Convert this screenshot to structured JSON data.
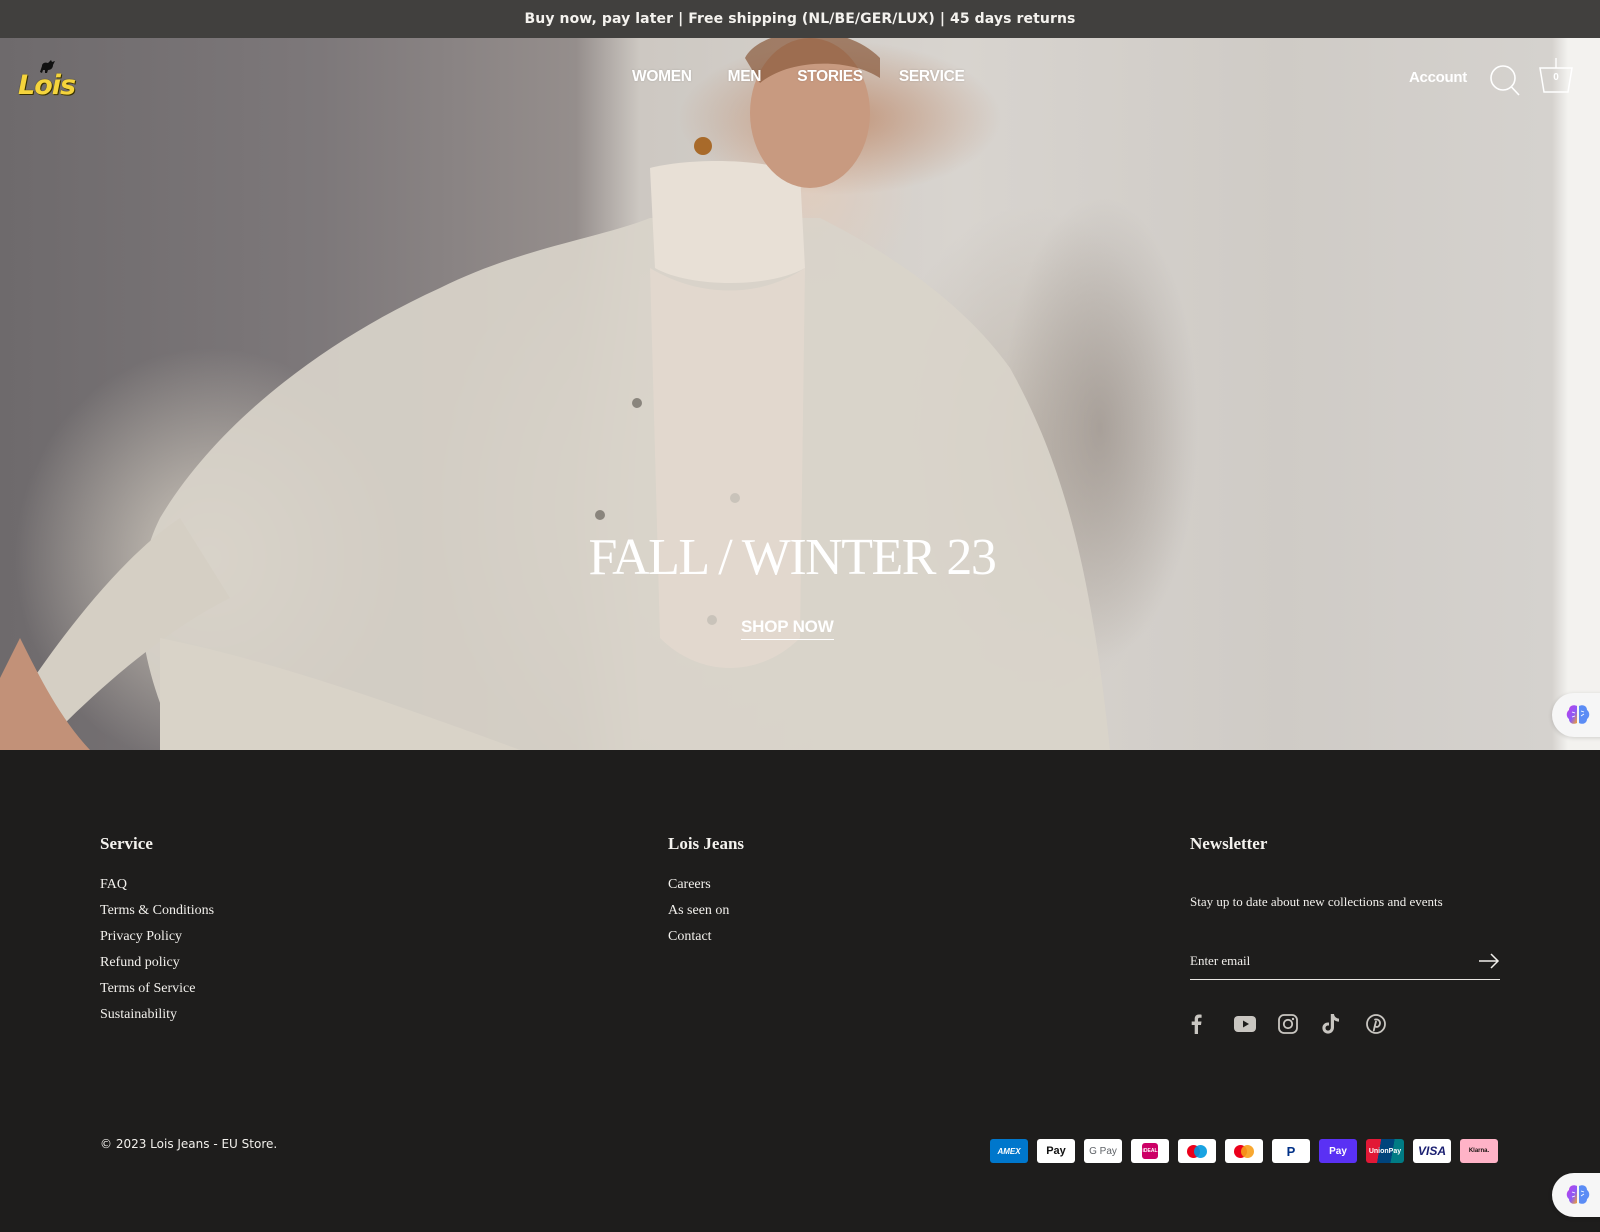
{
  "announcement": "Buy now, pay later | Free shipping (NL/BE/GER/LUX) | 45 days returns",
  "header": {
    "logo_text": "Lois",
    "nav": [
      {
        "label": "WOMEN"
      },
      {
        "label": "MEN"
      },
      {
        "label": "STORIES"
      },
      {
        "label": "SERVICE"
      }
    ],
    "account_label": "Account",
    "search_icon": "search-icon",
    "cart_icon": "cart-icon",
    "cart_count": "0"
  },
  "hero": {
    "title": "FALL / WINTER 23",
    "cta_label": "SHOP NOW"
  },
  "widget": {
    "icon": "brain-icon"
  },
  "footer": {
    "columns": [
      {
        "title": "Service",
        "links": [
          "FAQ",
          "Terms & Conditions",
          "Privacy Policy",
          "Refund policy",
          "Terms of Service",
          "Sustainability"
        ]
      },
      {
        "title": "Lois Jeans",
        "links": [
          "Careers",
          "As seen on",
          "Contact"
        ]
      }
    ],
    "newsletter": {
      "title": "Newsletter",
      "description": "Stay up to date about new collections and events",
      "email_placeholder": "Enter email",
      "email_value": "",
      "submit_icon": "arrow-right-icon"
    },
    "socials": [
      "facebook-icon",
      "youtube-icon",
      "instagram-icon",
      "tiktok-icon",
      "pinterest-icon"
    ],
    "copyright": "© 2023 Lois Jeans - EU Store.",
    "payments": [
      {
        "name": "American Express",
        "label": "AMEX"
      },
      {
        "name": "Apple Pay",
        "label": " Pay"
      },
      {
        "name": "Google Pay",
        "label": "G Pay"
      },
      {
        "name": "iDEAL",
        "label": "iDEAL"
      },
      {
        "name": "Maestro",
        "label": ""
      },
      {
        "name": "Mastercard",
        "label": ""
      },
      {
        "name": "PayPal",
        "label": "P"
      },
      {
        "name": "Shop Pay",
        "label": "Pay"
      },
      {
        "name": "UnionPay",
        "label": "UnionPay"
      },
      {
        "name": "Visa",
        "label": "VISA"
      },
      {
        "name": "Klarna",
        "label": "Klarna."
      }
    ]
  }
}
